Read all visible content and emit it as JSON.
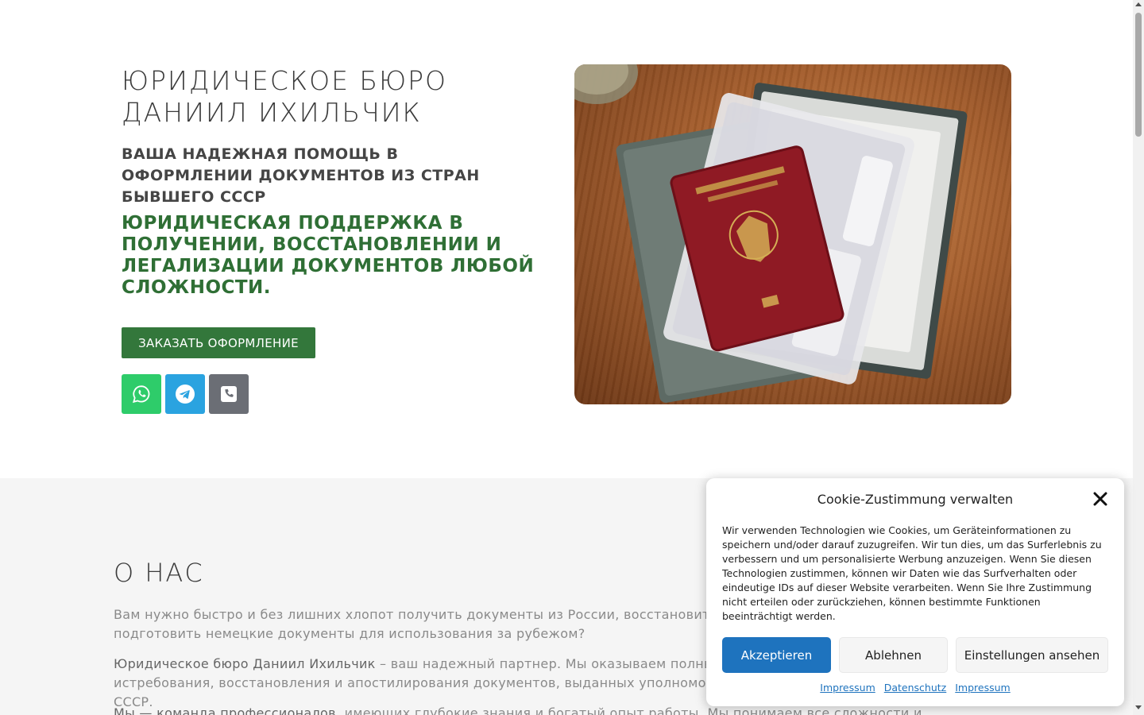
{
  "hero": {
    "title": "ЮРИДИЧЕСКОЕ БЮРО ДАНИИЛ ИХИЛЬЧИК",
    "subtitle": "ВАША НАДЕЖНАЯ ПОМОЩЬ В ОФОРМЛЕНИИ ДОКУМЕНТОВ ИЗ СТРАН БЫВШЕГО СССР",
    "lead": "ЮРИДИЧЕСКАЯ ПОДДЕРЖКА В ПОЛУЧЕНИИ, ВОССТАНОВЛЕНИИ И ЛЕГАЛИЗАЦИИ ДОКУМЕНТОВ ЛЮБОЙ СЛОЖНОСТИ.",
    "cta_label": "ЗАКАЗАТЬ ОФОРМЛЕНИЕ",
    "social": [
      {
        "icon": "whatsapp-icon",
        "color": "#2ecc6a"
      },
      {
        "icon": "telegram-icon",
        "color": "#2aa3e0"
      },
      {
        "icon": "phone-icon",
        "color": "#6b6e75"
      }
    ]
  },
  "about": {
    "title": "О НАС",
    "p1": "Вам нужно быстро и без лишних хлопот получить документы из России, восстановить утерянные документы или подготовить немецкие документы для использования за рубежом?",
    "p2_strong": "Юридическое бюро Даниил Ихильчик",
    "p2_rest": " – ваш надежный партнер. Мы оказываем полный спектр услуг в области истребования, восстановления и апостилирования документов, выданных уполномоченными органами стран бывшего СССР.",
    "p3_strong": "Мы — команда профессионалов",
    "p3_rest": ", имеющих глубокие знания и богатый опыт работы. Мы понимаем все сложности и нюансы"
  },
  "cookie": {
    "title": "Cookie-Zustimmung verwalten",
    "text": "Wir verwenden Technologien wie Cookies, um Geräteinformationen zu speichern und/oder darauf zuzugreifen. Wir tun dies, um das Surferlebnis zu verbessern und um personalisierte Werbung anzuzeigen. Wenn Sie diesen Technologien zustimmen, können wir Daten wie das Surfverhalten oder eindeutige IDs auf dieser Website verarbeiten. Wenn Sie Ihre Zustimmung nicht erteilen oder zurückziehen, können bestimmte Funktionen beeinträchtigt werden.",
    "accept_label": "Akzeptieren",
    "deny_label": "Ablehnen",
    "prefs_label": "Einstellungen ansehen",
    "links": [
      "Impressum",
      "Datenschutz",
      "Impressum"
    ],
    "accent_color": "#1e73be"
  },
  "colors": {
    "green": "#33773b",
    "lead_green": "#2f6f35",
    "about_bg": "#f5f5f5"
  }
}
